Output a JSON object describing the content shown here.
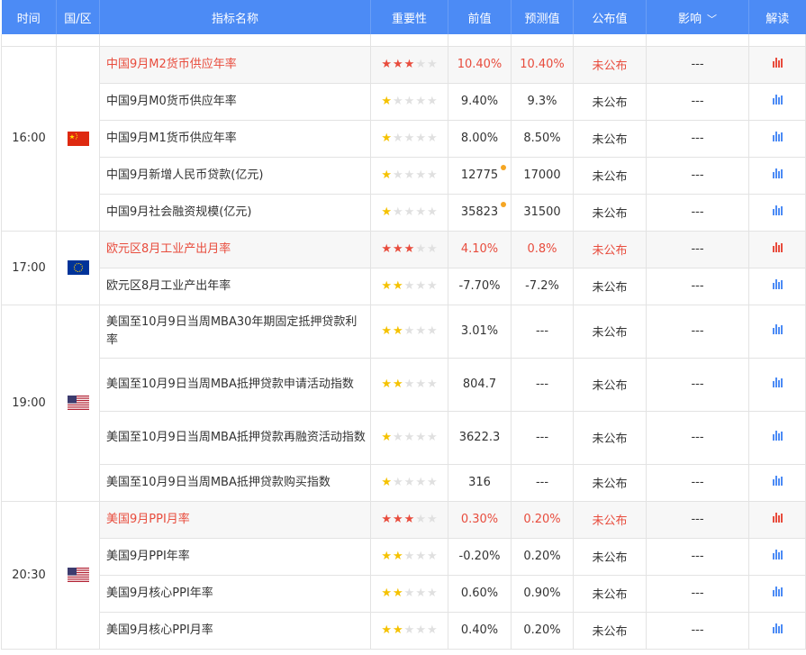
{
  "header": {
    "time": "时间",
    "region": "国/区",
    "indicator": "指标名称",
    "importance": "重要性",
    "previous": "前值",
    "forecast": "预测值",
    "actual": "公布值",
    "impact": "影响",
    "analysis": "解读"
  },
  "colors": {
    "header_bg": "#4c8bf5",
    "highlight": "#e84c3d",
    "star_yellow": "#f5c200",
    "dot_orange": "#f5a623"
  },
  "groups": [
    {
      "time": "16:00",
      "flag": "china-flag-icon",
      "rows": [
        {
          "name": "中国9月M2货币供应年率",
          "stars": 3,
          "prev": "10.40%",
          "forecast": "10.40%",
          "actual": "未公布",
          "impact": "---",
          "important": true
        },
        {
          "name": "中国9月M0货币供应年率",
          "stars": 1,
          "prev": "9.40%",
          "forecast": "9.3%",
          "actual": "未公布",
          "impact": "---",
          "important": false
        },
        {
          "name": "中国9月M1货币供应年率",
          "stars": 1,
          "prev": "8.00%",
          "forecast": "8.50%",
          "actual": "未公布",
          "impact": "---",
          "important": false
        },
        {
          "name": "中国9月新增人民币贷款(亿元)",
          "stars": 1,
          "prev": "12775",
          "forecast": "17000",
          "actual": "未公布",
          "impact": "---",
          "important": false,
          "dot": true
        },
        {
          "name": "中国9月社会融资规模(亿元)",
          "stars": 1,
          "prev": "35823",
          "forecast": "31500",
          "actual": "未公布",
          "impact": "---",
          "important": false,
          "dot": true
        }
      ]
    },
    {
      "time": "17:00",
      "flag": "eu-flag-icon",
      "rows": [
        {
          "name": "欧元区8月工业产出月率",
          "stars": 3,
          "prev": "4.10%",
          "forecast": "0.8%",
          "actual": "未公布",
          "impact": "---",
          "important": true
        },
        {
          "name": "欧元区8月工业产出年率",
          "stars": 2,
          "prev": "-7.70%",
          "forecast": "-7.2%",
          "actual": "未公布",
          "impact": "---",
          "important": false
        }
      ]
    },
    {
      "time": "19:00",
      "flag": "us-flag-icon",
      "rows": [
        {
          "name": "美国至10月9日当周MBA30年期固定抵押贷款利率",
          "stars": 2,
          "prev": "3.01%",
          "forecast": "---",
          "actual": "未公布",
          "impact": "---",
          "important": false,
          "tall": true
        },
        {
          "name": "美国至10月9日当周MBA抵押贷款申请活动指数",
          "stars": 2,
          "prev": "804.7",
          "forecast": "---",
          "actual": "未公布",
          "impact": "---",
          "important": false,
          "tall": true
        },
        {
          "name": "美国至10月9日当周MBA抵押贷款再融资活动指数",
          "stars": 1,
          "prev": "3622.3",
          "forecast": "---",
          "actual": "未公布",
          "impact": "---",
          "important": false,
          "tall": true
        },
        {
          "name": "美国至10月9日当周MBA抵押贷款购买指数",
          "stars": 1,
          "prev": "316",
          "forecast": "---",
          "actual": "未公布",
          "impact": "---",
          "important": false
        }
      ]
    },
    {
      "time": "20:30",
      "flag": "us-flag-icon",
      "rows": [
        {
          "name": "美国9月PPI月率",
          "stars": 3,
          "prev": "0.30%",
          "forecast": "0.20%",
          "actual": "未公布",
          "impact": "---",
          "important": true
        },
        {
          "name": "美国9月PPI年率",
          "stars": 2,
          "prev": "-0.20%",
          "forecast": "0.20%",
          "actual": "未公布",
          "impact": "---",
          "important": false
        },
        {
          "name": "美国9月核心PPI年率",
          "stars": 2,
          "prev": "0.60%",
          "forecast": "0.90%",
          "actual": "未公布",
          "impact": "---",
          "important": false
        },
        {
          "name": "美国9月核心PPI月率",
          "stars": 2,
          "prev": "0.40%",
          "forecast": "0.20%",
          "actual": "未公布",
          "impact": "---",
          "important": false
        }
      ]
    }
  ]
}
